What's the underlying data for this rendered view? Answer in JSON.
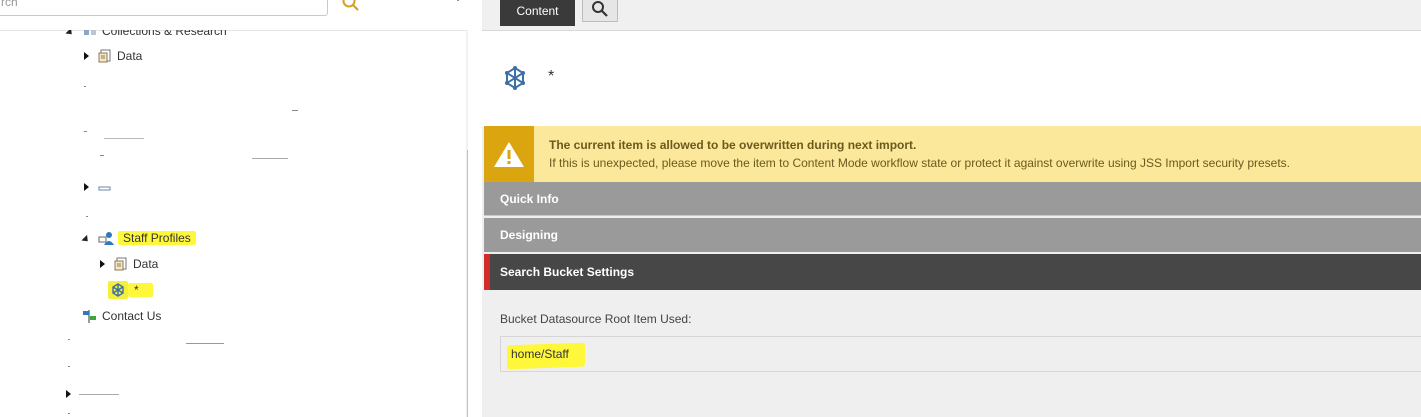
{
  "search": {
    "value": "rch",
    "placeholder": ""
  },
  "tree": {
    "collections": {
      "label": "Collections & Research",
      "icon": "collection-icon"
    },
    "data1": {
      "label": "Data",
      "icon": "folder-data-icon"
    },
    "staff": {
      "label": "Staff Profiles",
      "icon": "staff-profiles-icon"
    },
    "data2": {
      "label": "Data",
      "icon": "folder-data-icon"
    },
    "wildcard": {
      "label": "*",
      "icon": "wildcard-cube-icon"
    },
    "contact": {
      "label": "Contact Us",
      "icon": "signpost-icon"
    }
  },
  "tabs": {
    "content": "Content",
    "search_icon": "search-icon"
  },
  "item": {
    "title": "*",
    "icon": "wildcard-cube-icon"
  },
  "warning": {
    "title": "The current item is allowed to be overwritten during next import.",
    "text": "If this is unexpected, please move the item to Content Mode workflow state or protect it against overwrite using JSS Import security presets."
  },
  "sections": {
    "quick_info": "Quick Info",
    "designing": "Designing",
    "search_bucket": "Search Bucket Settings"
  },
  "bucket": {
    "label": "Bucket Datasource Root Item Used:",
    "value": "home/Staff"
  },
  "colors": {
    "highlight": "#fff83a",
    "warning_bg": "#fbe89a",
    "warning_icon": "#dba510",
    "section_active": "#474747",
    "section_active_accent": "#d22b2b",
    "section_inactive": "#9a9a9a"
  }
}
